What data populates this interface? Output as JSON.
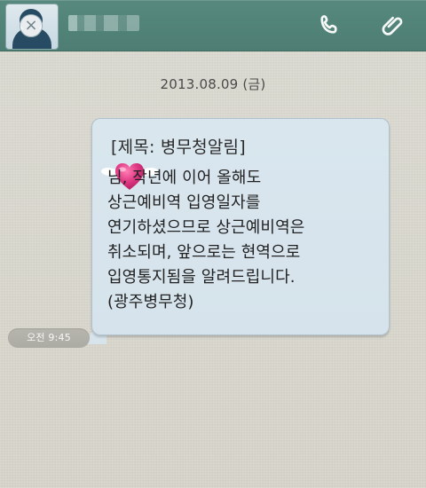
{
  "header": {
    "close_symbol": "×",
    "icons": {
      "call": "phone-icon",
      "attach": "paperclip-icon"
    }
  },
  "conversation": {
    "date": "2013.08.09 (금)",
    "message": {
      "title": "[제목: 병무청알림]",
      "body": "님, 작년에 이어 올해도\n상근예비역 입영일자를\n연기하셨으므로 상근예비역은\n취소되며, 앞으로는 현역으로\n입영통지됨을 알려드립니다.\n(광주병무청)",
      "time": "오전 9:45"
    }
  },
  "colors": {
    "header": "#4d7d73",
    "bubble": "#d8e5ed",
    "background": "#d8d6cd",
    "heart": "#d9307b"
  }
}
